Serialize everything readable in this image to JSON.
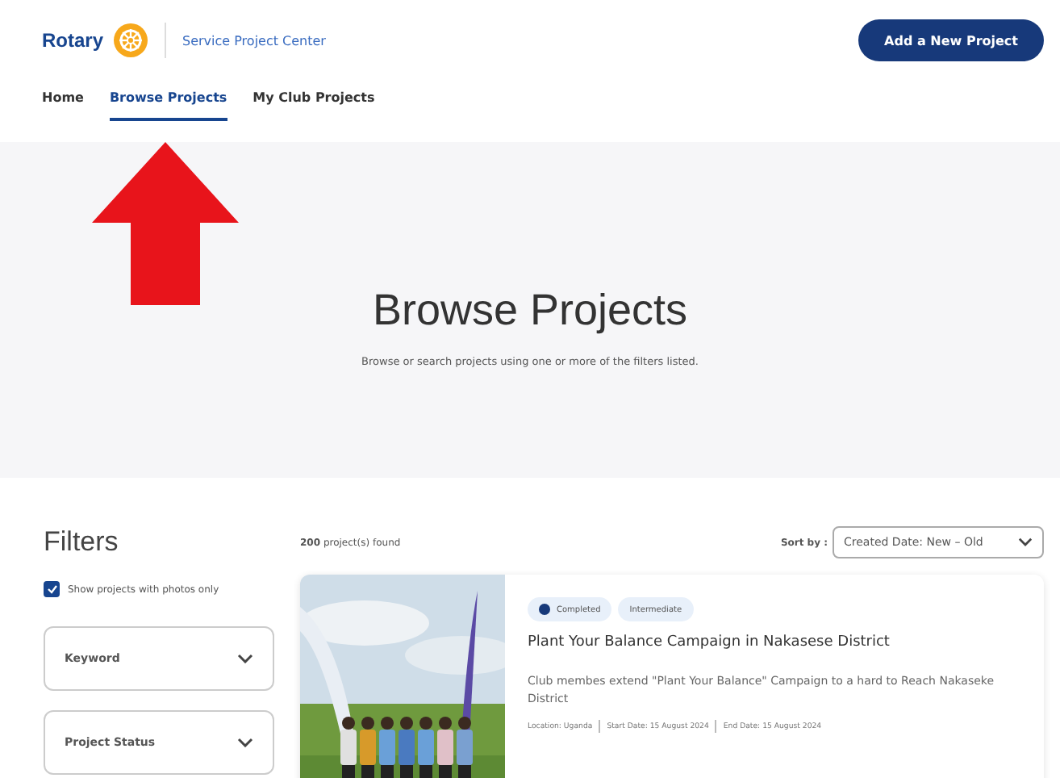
{
  "header": {
    "logo_text": "Rotary",
    "site_title": "Service Project Center",
    "add_button": "Add a New Project"
  },
  "nav": [
    {
      "label": "Home",
      "selected": false
    },
    {
      "label": "Browse Projects",
      "selected": true
    },
    {
      "label": "My Club Projects",
      "selected": false
    }
  ],
  "hero": {
    "title": "Browse Projects",
    "subtitle": "Browse or search projects using one or more of the filters listed."
  },
  "filters": {
    "title": "Filters",
    "photos_only": {
      "label": "Show projects with photos only",
      "checked": true
    },
    "dropdowns": [
      {
        "label": "Keyword",
        "expanded": false
      },
      {
        "label": "Project Status",
        "expanded": false
      }
    ]
  },
  "results": {
    "count": "200",
    "count_label": "project(s) found",
    "sort_label": "Sort by :",
    "sort_value": "Created Date: New – Old"
  },
  "projects": [
    {
      "kind": "picture",
      "status": "Completed",
      "level": "Intermediate",
      "title": "Plant Your Balance Campaign in Nakasese District",
      "description": "Club membes extend \"Plant Your Balance\" Campaign to a hard to Reach Nakaseke District",
      "meta": [
        "Location: Uganda",
        "Start Date: 15 August 2024",
        "End Date: 15 August 2024"
      ]
    }
  ]
}
